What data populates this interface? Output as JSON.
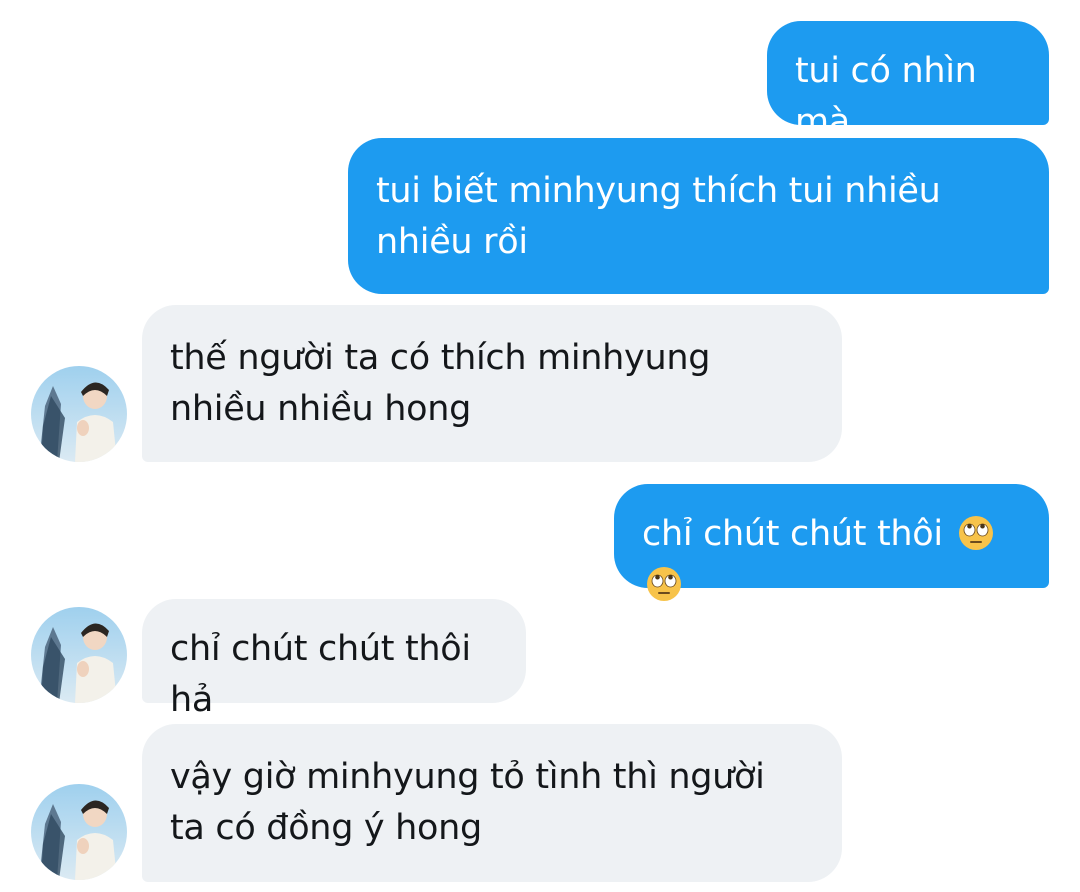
{
  "colors": {
    "sent_bubble": "#1d9bf0",
    "sent_text": "#ffffff",
    "received_bubble": "#eef1f4",
    "received_text": "#14171a"
  },
  "messages": [
    {
      "side": "sent",
      "text": "tui có nhìn mà"
    },
    {
      "side": "sent",
      "text": "tui biết minhyung thích tui nhiều nhiều rồi"
    },
    {
      "side": "received",
      "text": "thế người ta có thích minhyung nhiều nhiều hong"
    },
    {
      "side": "sent",
      "text": "chỉ chút chút thôi",
      "emojis": [
        "face-with-rolling-eyes-icon",
        "face-with-rolling-eyes-icon"
      ]
    },
    {
      "side": "received",
      "text": "chỉ chút chút thôi hả"
    },
    {
      "side": "received",
      "text": "vậy giờ minhyung tỏ tình thì người ta có đồng ý hong"
    }
  ]
}
